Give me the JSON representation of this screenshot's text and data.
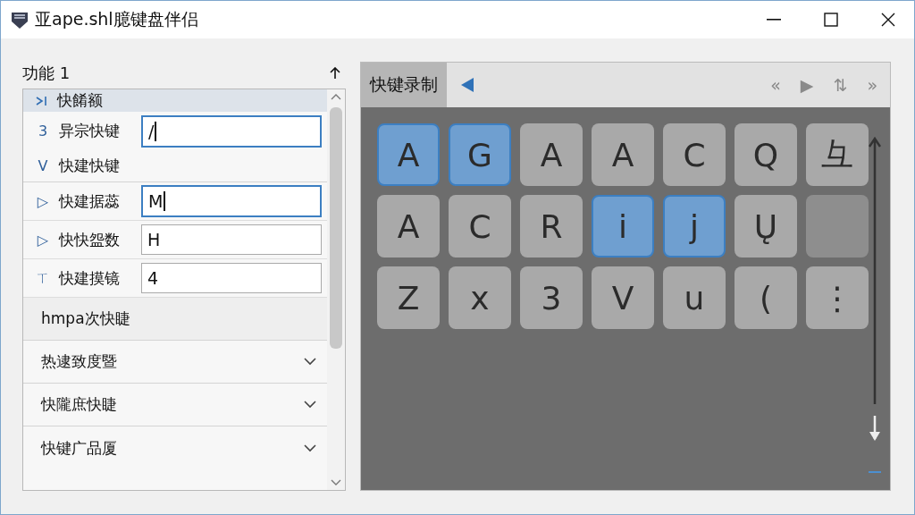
{
  "window": {
    "title": "亚ape.shl臆键盘伴侣"
  },
  "panel": {
    "title": "功能 1"
  },
  "rows": [
    {
      "kind": "header",
      "label": "快餚额",
      "selected": true
    },
    {
      "kind": "field",
      "marker": "3",
      "label": "异宗快键",
      "value": "/",
      "focused": true
    },
    {
      "kind": "plain",
      "marker": "V",
      "label": "快建快键"
    },
    {
      "kind": "field",
      "marker": "▷",
      "label": "快建据蕊",
      "value": "M",
      "focused": true
    },
    {
      "kind": "field",
      "marker": "▷",
      "label": "快快盌数",
      "value": "H",
      "focused": false
    },
    {
      "kind": "field",
      "marker": "ㄒ",
      "label": "快建摸镜",
      "value": "4",
      "focused": false
    },
    {
      "kind": "section",
      "label": "hmpa次快睫"
    },
    {
      "kind": "dropdown",
      "label": "热逮致度暨",
      "expanded": false
    },
    {
      "kind": "dropdown",
      "label": "快隴庶快睫",
      "expanded": false
    },
    {
      "kind": "dropdown",
      "label": "快键广品厦",
      "expanded": false
    }
  ],
  "recorder": {
    "tab": "快键录制",
    "tools": [
      "«",
      "▶",
      "⇅",
      "»"
    ],
    "keys": [
      {
        "label": "A",
        "selected": true
      },
      {
        "label": "G",
        "selected": true
      },
      {
        "label": "A",
        "selected": false
      },
      {
        "label": "A",
        "selected": false
      },
      {
        "label": "C",
        "selected": false
      },
      {
        "label": "Q",
        "selected": false
      },
      {
        "label": "彑",
        "selected": false
      },
      {
        "label": "A",
        "selected": false
      },
      {
        "label": "C",
        "selected": false
      },
      {
        "label": "R",
        "selected": false
      },
      {
        "label": "i",
        "selected": true
      },
      {
        "label": "j",
        "selected": true
      },
      {
        "label": "Ų",
        "selected": false
      },
      {
        "selected": false
      },
      {
        "label": "Z",
        "selected": false
      },
      {
        "label": "x",
        "selected": false
      },
      {
        "label": "3",
        "selected": false
      },
      {
        "label": "V",
        "selected": false
      },
      {
        "label": "u",
        "selected": false
      },
      {
        "label": "(",
        "selected": false
      },
      {
        "label": "⋮",
        "selected": false
      }
    ]
  }
}
